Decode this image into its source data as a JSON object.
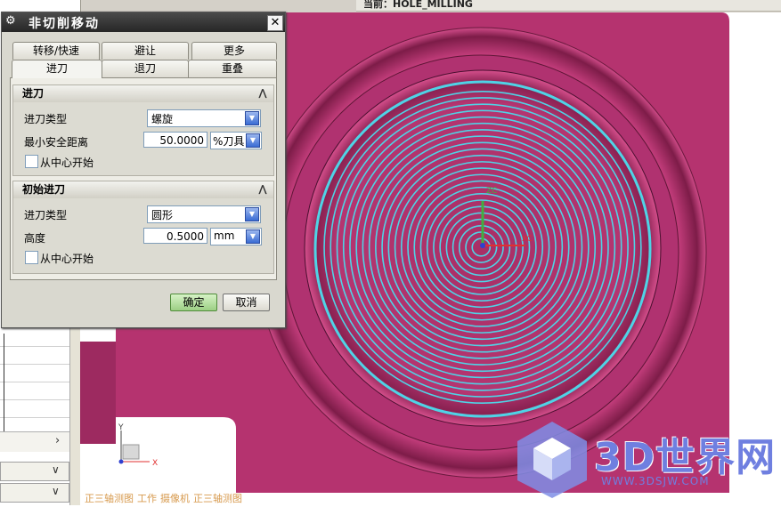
{
  "top_status": {
    "text": "当前：HOLE_MILLING"
  },
  "dialog": {
    "title": "非切削移动",
    "icons": {
      "settings": "gear-icon",
      "close": "close-icon"
    },
    "tabs_back": [
      "转移/快速",
      "避让",
      "更多"
    ],
    "tabs_front": [
      "进刀",
      "退刀",
      "重叠"
    ],
    "active_tab": "进刀",
    "groups": [
      {
        "header": "进刀",
        "type_label": "进刀类型",
        "type_value": "螺旋",
        "distance_label": "最小安全距离",
        "distance_value": "50.0000",
        "distance_unit": "%刀具",
        "checkbox_label": "从中心开始",
        "checkbox_checked": false
      },
      {
        "header": "初始进刀",
        "type_label": "进刀类型",
        "type_value": "圆形",
        "height_label": "高度",
        "height_value": "0.5000",
        "height_unit": "mm",
        "checkbox_label": "从中心开始",
        "checkbox_checked": false
      }
    ],
    "ok_label": "确定",
    "cancel_label": "取消"
  },
  "left_panel": {
    "scroll_arrow": "›",
    "combo_arrow": "∨"
  },
  "viewport": {
    "status_items": [
      "正三轴测图",
      "工作",
      "摄像机",
      "正三轴测图"
    ],
    "axis_labels": {
      "x": "X",
      "y": "Y",
      "zc": "ZC",
      "xc": "XC"
    },
    "colors": {
      "part": "#b5336f",
      "toolpath": "#4fd3e6",
      "axis_x": "#e03030",
      "axis_y": "#40b040"
    }
  },
  "watermark": {
    "title": "3D世界网",
    "url": "WWW.3DSJW.COM"
  }
}
